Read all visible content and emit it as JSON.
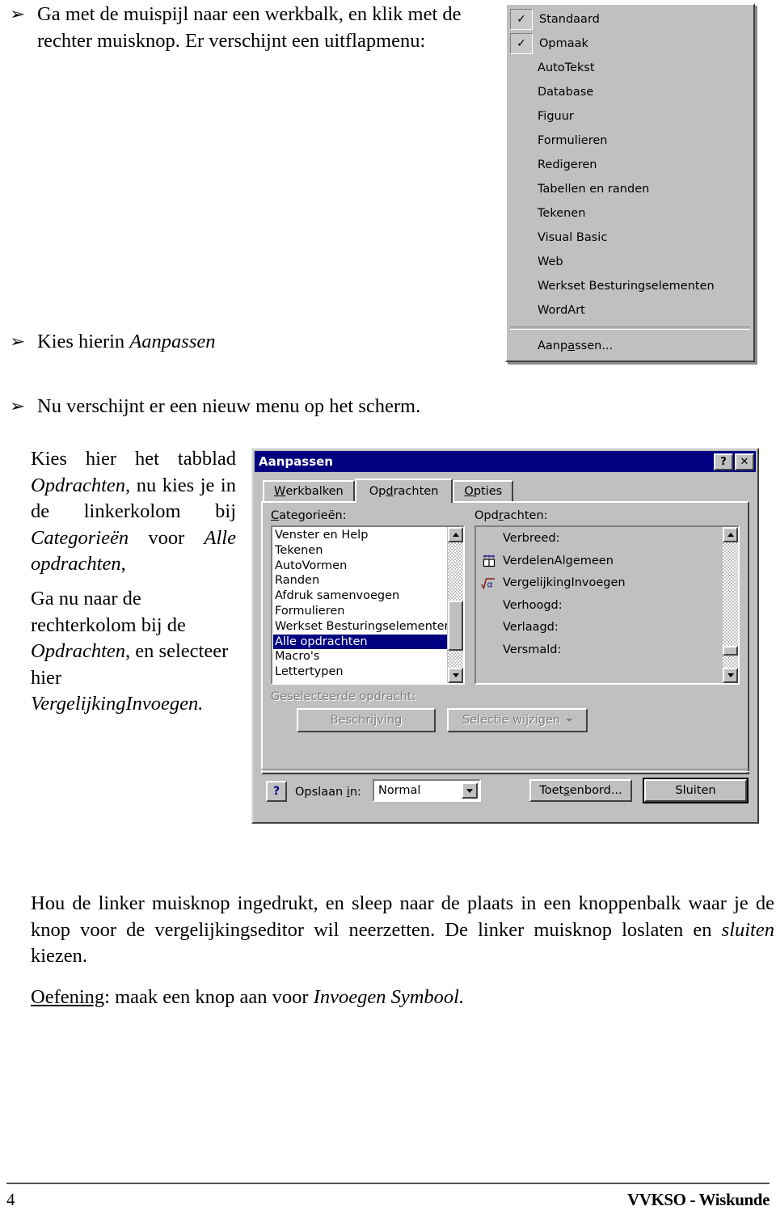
{
  "document": {
    "bullets": [
      {
        "glyph": "➢",
        "text": "Ga met de muispijl naar een werkbalk, en klik met de rechter muisknop. Er verschijnt een uitflapmenu:"
      },
      {
        "glyph": "➢",
        "text_plain": "Kies hierin ",
        "text_italic": "Aanpassen"
      },
      {
        "glyph": "➢",
        "text": "Nu verschijnt er een nieuw menu op het scherm."
      }
    ],
    "side_paragraph_1": {
      "p1": "Kies hier het tabblad ",
      "p2": "Opdrachten,",
      "p3": " nu kies je in de linkerkolom bij ",
      "p4": "Categorieën",
      "p5": " voor ",
      "p6": "Alle opdrachten",
      "p7": ","
    },
    "side_paragraph_2": {
      "p1": "Ga nu naar de rechterkolom bij de ",
      "p2": "Opdrachten",
      "p3": ", en selecteer hier ",
      "p4": "VergelijkingInvoegen."
    },
    "closing_paragraph": {
      "p1": "Hou de linker muisknop ingedrukt, en sleep naar de plaats in een knoppenbalk waar je de knop voor de vergelijkingseditor wil neerzetten. De linker muisknop loslaten en ",
      "p2": "sluiten",
      "p3": " kiezen."
    },
    "exercise_paragraph": {
      "label": "Oefening",
      "p1": ": maak een knop aan voor ",
      "p2": "Invoegen Symbool."
    },
    "footer": {
      "page_number": "4",
      "source": "VVKSO - Wiskunde"
    }
  },
  "toolbar_menu": {
    "items": [
      {
        "label": "Standaard",
        "checked": true
      },
      {
        "label": "Opmaak",
        "checked": true
      },
      {
        "label": "AutoTekst",
        "checked": false
      },
      {
        "label": "Database",
        "checked": false
      },
      {
        "label": "Figuur",
        "checked": false
      },
      {
        "label": "Formulieren",
        "checked": false
      },
      {
        "label": "Redigeren",
        "checked": false
      },
      {
        "label": "Tabellen en randen",
        "checked": false
      },
      {
        "label": "Tekenen",
        "checked": false
      },
      {
        "label": "Visual Basic",
        "checked": false
      },
      {
        "label": "Web",
        "checked": false
      },
      {
        "label": "Werkset Besturingselementen",
        "checked": false
      },
      {
        "label": "WordArt",
        "checked": false
      }
    ],
    "customize": {
      "before": "Aanp",
      "accel": "a",
      "after": "ssen..."
    },
    "check_glyph": "✓"
  },
  "dialog": {
    "title": "Aanpassen",
    "titlebar_buttons": {
      "help": "?",
      "close": "✕"
    },
    "tabs": [
      {
        "before": "",
        "accel": "W",
        "after": "erkbalken",
        "active": false
      },
      {
        "before": "Op",
        "accel": "d",
        "after": "rachten",
        "active": true
      },
      {
        "before": "",
        "accel": "O",
        "after": "pties",
        "active": false
      }
    ],
    "categories": {
      "label_before": "",
      "label_accel": "C",
      "label_after": "ategorieën:",
      "items": [
        {
          "label": "Venster en Help",
          "selected": false
        },
        {
          "label": "Tekenen",
          "selected": false
        },
        {
          "label": "AutoVormen",
          "selected": false
        },
        {
          "label": "Randen",
          "selected": false
        },
        {
          "label": "Afdruk samenvoegen",
          "selected": false
        },
        {
          "label": "Formulieren",
          "selected": false
        },
        {
          "label": "Werkset Besturingselementen",
          "selected": false
        },
        {
          "label": "Alle opdrachten",
          "selected": true
        },
        {
          "label": "Macro's",
          "selected": false
        },
        {
          "label": "Lettertypen",
          "selected": false
        }
      ]
    },
    "commands": {
      "label_before": "Opd",
      "label_accel": "r",
      "label_after": "achten:",
      "items": [
        {
          "label": "Verbreed:",
          "icon": "none"
        },
        {
          "label": "VerdelenAlgemeen",
          "icon": "table-distribute-icon"
        },
        {
          "label": "VergelijkingInvoegen",
          "icon": "equation-editor-icon"
        },
        {
          "label": "Verhoogd:",
          "icon": "none"
        },
        {
          "label": "Verlaagd:",
          "icon": "none"
        },
        {
          "label": "Versmald:",
          "icon": "none"
        }
      ]
    },
    "selected_command": {
      "label": "Geselecteerde opdracht:",
      "description_button": "Beschrijving",
      "modify_button": "Selectie wijzigen"
    },
    "bottom": {
      "help_button": "?",
      "save_in_label_before": "Opslaan ",
      "save_in_label_accel": "i",
      "save_in_label_after": "n:",
      "save_in_value": "Normal",
      "keyboard_button_before": "Toet",
      "keyboard_button_accel": "s",
      "keyboard_button_after": "enbord...",
      "close_button": "Sluiten"
    }
  },
  "colors": {
    "titlebar": "#000080",
    "selection": "#000080",
    "face": "#c0c0c0",
    "field": "#ffffff"
  }
}
